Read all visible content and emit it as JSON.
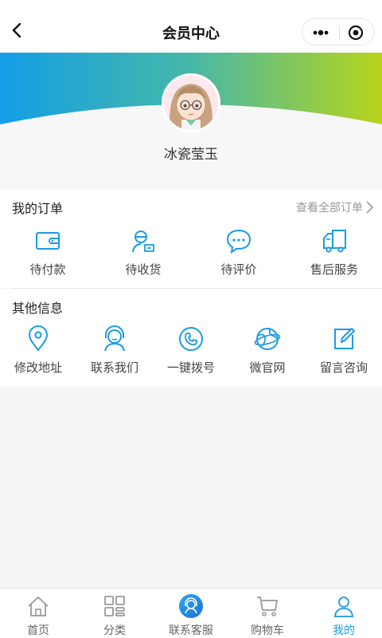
{
  "header": {
    "title": "会员中心"
  },
  "profile": {
    "username": "冰瓷莹玉"
  },
  "orders": {
    "title": "我的订单",
    "view_all": "查看全部订单",
    "items": [
      {
        "label": "待付款",
        "icon": "wallet-icon"
      },
      {
        "label": "待收货",
        "icon": "delivery-person-icon"
      },
      {
        "label": "待评价",
        "icon": "chat-bubble-icon"
      },
      {
        "label": "售后服务",
        "icon": "truck-icon"
      }
    ]
  },
  "others": {
    "title": "其他信息",
    "items": [
      {
        "label": "修改地址",
        "icon": "location-pin-icon"
      },
      {
        "label": "联系我们",
        "icon": "customer-service-icon"
      },
      {
        "label": "一键拨号",
        "icon": "phone-icon"
      },
      {
        "label": "微官网",
        "icon": "globe-icon"
      },
      {
        "label": "留言咨询",
        "icon": "edit-icon"
      }
    ]
  },
  "tabbar": {
    "items": [
      {
        "label": "首页",
        "icon": "home-icon"
      },
      {
        "label": "分类",
        "icon": "category-grid-icon"
      },
      {
        "label": "联系客服",
        "icon": "headset-icon"
      },
      {
        "label": "购物车",
        "icon": "cart-icon"
      },
      {
        "label": "我的",
        "icon": "user-icon",
        "active": true
      }
    ]
  },
  "colors": {
    "accent": "#1a9be6",
    "gradient_start": "#139ee6",
    "gradient_end": "#b8d41a"
  }
}
